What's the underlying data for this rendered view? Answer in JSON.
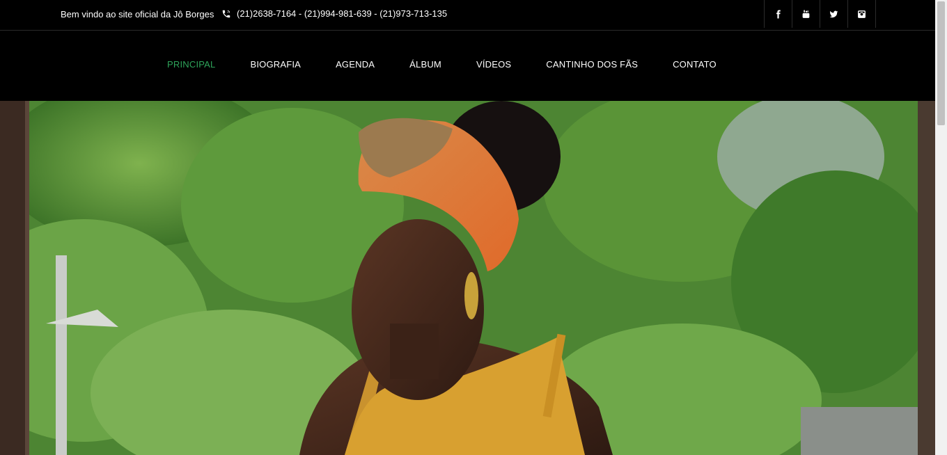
{
  "topbar": {
    "welcome": "Bem vindo ao site oficial da Jô Borges",
    "phones": "(21)2638-7164 - (21)994-981-639 - (21)973-713-135",
    "social": [
      {
        "name": "facebook-icon"
      },
      {
        "name": "youtube-icon"
      },
      {
        "name": "twitter-icon"
      },
      {
        "name": "instagram-icon"
      }
    ]
  },
  "nav": {
    "items": [
      {
        "label": "PRINCIPAL",
        "active": true
      },
      {
        "label": "BIOGRAFIA"
      },
      {
        "label": "AGENDA"
      },
      {
        "label": "ÁLBUM"
      },
      {
        "label": "VÍDEOS"
      },
      {
        "label": "CANTINHO DOS FÃS"
      },
      {
        "label": "CONTATO"
      }
    ]
  },
  "colors": {
    "background": "#000000",
    "accent": "#2ea35a",
    "nav_text": "#ffffff"
  }
}
